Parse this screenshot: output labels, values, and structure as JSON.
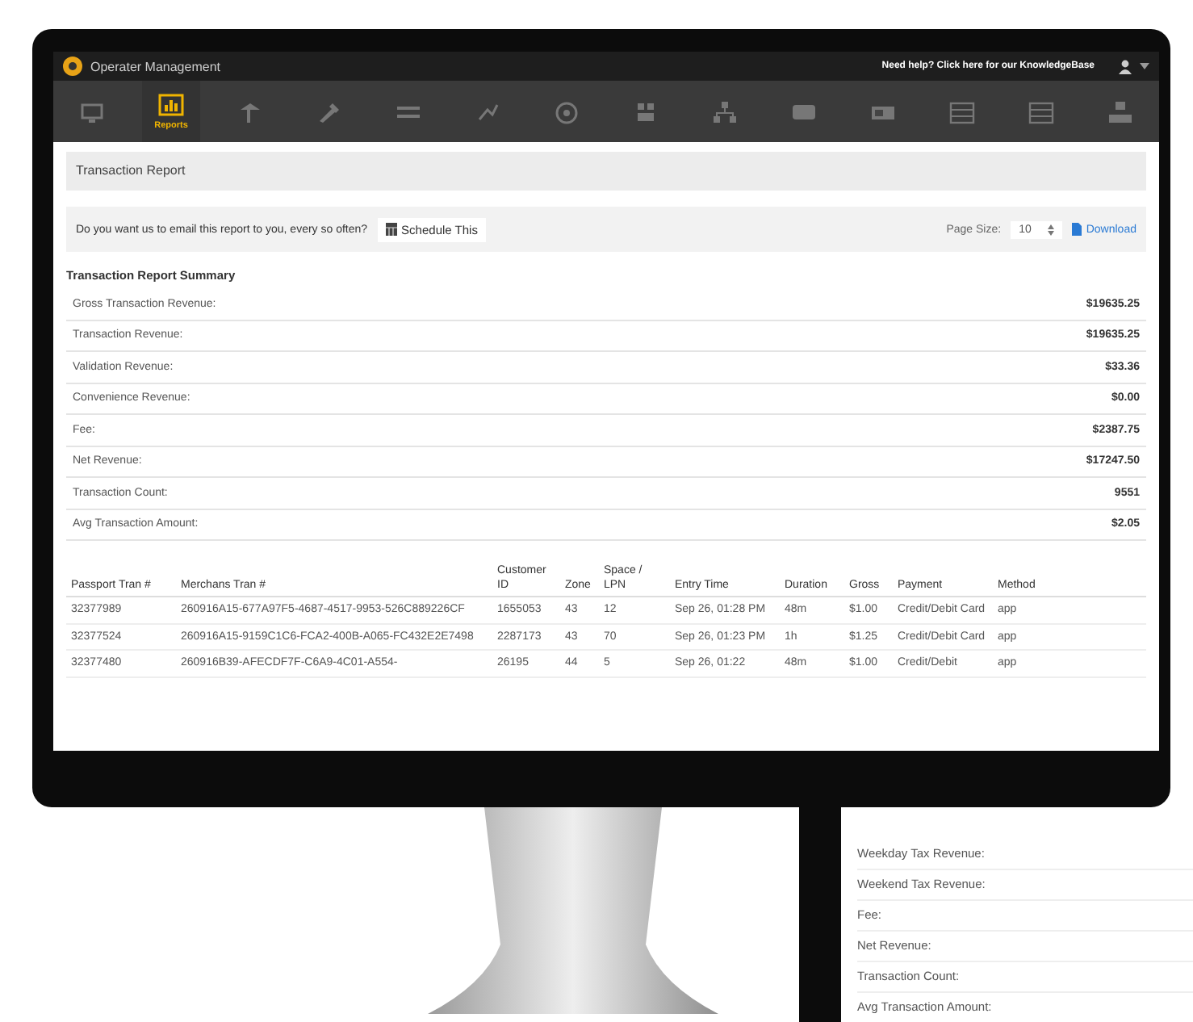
{
  "top_bar": {
    "app_title": "Operater Management",
    "help_link": "Need help? Click here for our KnowledgeBase"
  },
  "nav": [
    {
      "selected": false
    },
    {
      "label": "Reports",
      "selected": true
    },
    {
      "selected": false
    },
    {
      "selected": false
    },
    {
      "selected": false
    },
    {
      "selected": false
    },
    {
      "selected": false
    },
    {
      "selected": false
    },
    {
      "selected": false
    },
    {
      "selected": false
    },
    {
      "selected": false
    },
    {
      "selected": false
    },
    {
      "selected": false
    },
    {
      "selected": false
    }
  ],
  "page_title": "Transaction Report",
  "email_bar": {
    "prompt": "Do you want us to email this report to you, every so often?",
    "schedule_button": "Schedule This",
    "page_size_label": "Page Size:",
    "page_size": "10",
    "download": "Download"
  },
  "summary": {
    "title": "Transaction Report Summary",
    "rows": [
      {
        "label": "Gross Transaction Revenue:",
        "value": "$19635.25"
      },
      {
        "label": "Transaction Revenue:",
        "value": "$19635.25"
      },
      {
        "label": "Validation Revenue:",
        "value": "$33.36"
      },
      {
        "label": "Convenience Revenue:",
        "value": "$0.00"
      },
      {
        "label": "Fee:",
        "value": "$2387.75"
      },
      {
        "label": "Net Revenue:",
        "value": "$17247.50"
      },
      {
        "label": "Transaction Count:",
        "value": "9551"
      },
      {
        "label": "Avg Transaction Amount:",
        "value": "$2.05"
      }
    ]
  },
  "table": {
    "columns": [
      "Passport Tran #",
      "Merchans Tran #",
      "Customer ID",
      "Zone",
      "Space / LPN",
      "Entry Time",
      "Duration",
      "Gross",
      "Payment",
      "Method"
    ],
    "rows": [
      [
        "32377989",
        "260916A15-677A97F5-4687-4517-9953-526C889226CF",
        "1655053",
        "43",
        "12",
        "Sep 26, 01:28 PM",
        "48m",
        "$1.00",
        "Credit/Debit Card",
        "app"
      ],
      [
        "32377524",
        "260916A15-9159C1C6-FCA2-400B-A065-FC432E2E7498",
        "2287173",
        "43",
        "70",
        "Sep 26, 01:23 PM",
        "1h",
        "$1.25",
        "Credit/Debit Card",
        "app"
      ],
      [
        "32377480",
        "260916B39-AFECDF7F-C6A9-4C01-A554-",
        "26195",
        "44",
        "5",
        "Sep 26, 01:22",
        "48m",
        "$1.00",
        "Credit/Debit",
        "app"
      ]
    ]
  },
  "second_device": {
    "rows": [
      "Weekday Tax Revenue:",
      "Weekend Tax Revenue:",
      "Fee:",
      "Net Revenue:",
      "Transaction Count:",
      "Avg Transaction Amount:"
    ]
  }
}
